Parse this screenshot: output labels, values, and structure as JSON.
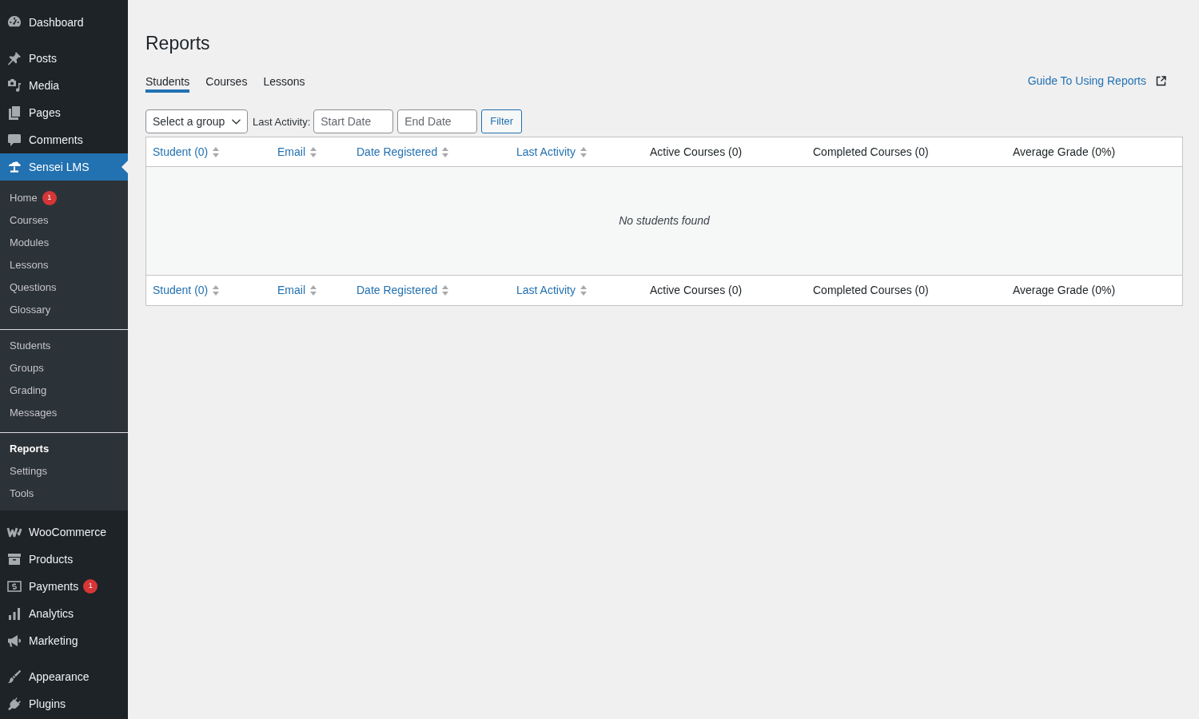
{
  "sidebar": {
    "sections": [
      {
        "items": [
          {
            "label": "Dashboard",
            "selected": false
          }
        ]
      },
      {
        "items": [
          {
            "label": "Posts",
            "selected": false
          },
          {
            "label": "Media",
            "selected": false
          },
          {
            "label": "Pages",
            "selected": false
          },
          {
            "label": "Comments",
            "selected": false
          },
          {
            "label": "Sensei LMS",
            "selected": true,
            "submenu": [
              {
                "items": [
                  {
                    "label": "Home",
                    "selected": false,
                    "badge": "1"
                  },
                  {
                    "label": "Courses",
                    "selected": false
                  },
                  {
                    "label": "Modules",
                    "selected": false
                  },
                  {
                    "label": "Lessons",
                    "selected": false
                  },
                  {
                    "label": "Questions",
                    "selected": false
                  },
                  {
                    "label": "Glossary",
                    "selected": false
                  }
                ]
              },
              {
                "items": [
                  {
                    "label": "Students",
                    "selected": false
                  },
                  {
                    "label": "Groups",
                    "selected": false
                  },
                  {
                    "label": "Grading",
                    "selected": false
                  },
                  {
                    "label": "Messages",
                    "selected": false
                  }
                ]
              },
              {
                "items": [
                  {
                    "label": "Reports",
                    "selected": true
                  },
                  {
                    "label": "Settings",
                    "selected": false
                  },
                  {
                    "label": "Tools",
                    "selected": false
                  }
                ]
              }
            ]
          },
          {
            "label": "WooCommerce",
            "selected": false
          },
          {
            "label": "Products",
            "selected": false
          },
          {
            "label": "Payments",
            "selected": false,
            "badge": "1"
          },
          {
            "label": "Analytics",
            "selected": false
          },
          {
            "label": "Marketing",
            "selected": false
          }
        ]
      },
      {
        "items": [
          {
            "label": "Appearance",
            "selected": false
          },
          {
            "label": "Plugins",
            "selected": false
          }
        ]
      }
    ]
  },
  "page": {
    "title": "Reports",
    "tabs": [
      {
        "label": "Students",
        "selected": true
      },
      {
        "label": "Courses",
        "selected": false
      },
      {
        "label": "Lessons",
        "selected": false
      }
    ],
    "guide_link": "Guide To Using Reports"
  },
  "filters": {
    "group_select": {
      "value": "Select a group"
    },
    "last_activity_label": "Last Activity:",
    "start_date": {
      "placeholder": "Start Date"
    },
    "end_date": {
      "placeholder": "End Date"
    },
    "filter_button": "Filter"
  },
  "table": {
    "columns": [
      {
        "label": "Student (0)",
        "sortable": true
      },
      {
        "label": "Email",
        "sortable": true
      },
      {
        "label": "Date Registered",
        "sortable": true
      },
      {
        "label": "Last Activity",
        "sortable": true
      },
      {
        "label": "Active Courses (0)",
        "sortable": false
      },
      {
        "label": "Completed Courses (0)",
        "sortable": false
      },
      {
        "label": "Average Grade (0%)",
        "sortable": false
      }
    ],
    "empty_message": "No students found",
    "footer_columns": [
      {
        "label": "Student (0)",
        "sortable": true
      },
      {
        "label": "Email",
        "sortable": true
      },
      {
        "label": "Date Registered",
        "sortable": true
      },
      {
        "label": "Last Activity",
        "sortable": true
      },
      {
        "label": "Active Courses (0)",
        "sortable": false
      },
      {
        "label": "Completed Courses (0)",
        "sortable": false
      },
      {
        "label": "Average Grade (0%)",
        "sortable": false
      }
    ]
  }
}
